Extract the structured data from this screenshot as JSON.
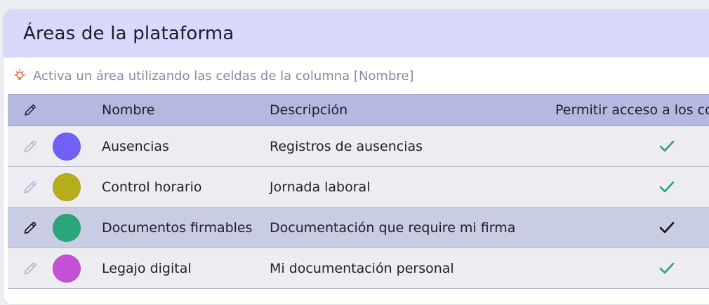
{
  "panel": {
    "title": "Áreas de la plataforma",
    "hint": "Activa un área utilizando las celdas de la columna [Nombre]"
  },
  "table": {
    "columns": {
      "name": "Nombre",
      "description": "Descripción",
      "access": "Permitir acceso a los co"
    },
    "rows": [
      {
        "name": "Ausencias",
        "description": "Registros de ausencias",
        "color": "#7160f6",
        "access": true,
        "selected": false
      },
      {
        "name": "Control horario",
        "description": "Jornada laboral",
        "color": "#b5ad19",
        "access": true,
        "selected": false
      },
      {
        "name": "Documentos firmables",
        "description": "Documentación que require mi firma",
        "color": "#2aa77a",
        "access": true,
        "selected": true
      },
      {
        "name": "Legajo digital",
        "description": "Mi documentación personal",
        "color": "#c552d6",
        "access": true,
        "selected": false
      }
    ]
  },
  "colors": {
    "header_bg": "#d9d9fb",
    "table_header_bg": "#b3b9e0",
    "selected_row_bg": "#c9cde4",
    "row_bg": "#ececf1",
    "check_active": "#27a27c",
    "check_selected": "#111111",
    "hint_icon": "#e3643a"
  }
}
